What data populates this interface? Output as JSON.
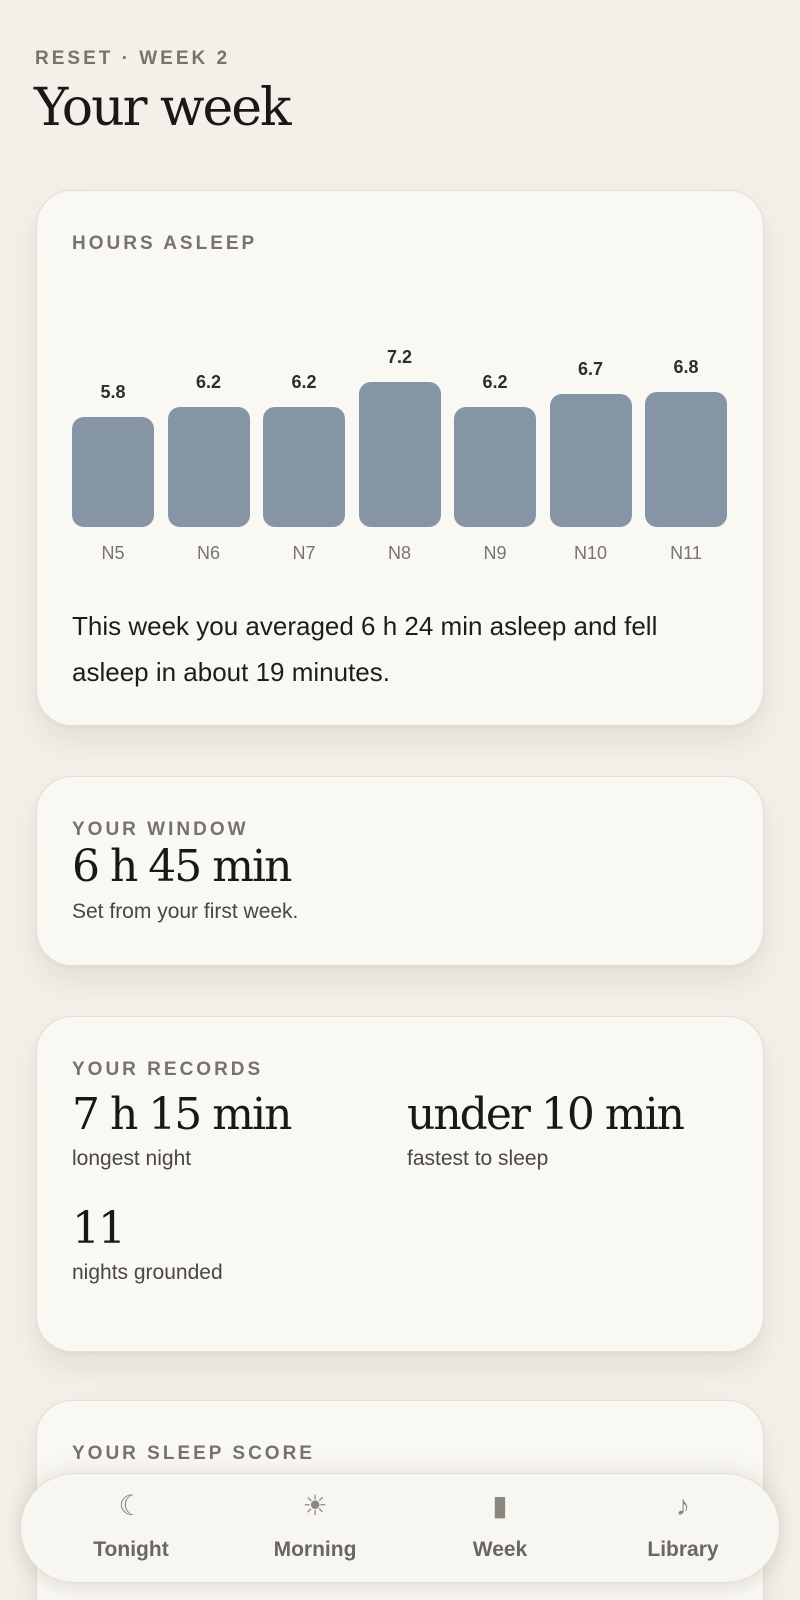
{
  "header": {
    "eyebrow": "RESET · WEEK 2",
    "title": "Your week"
  },
  "hours_card": {
    "label": "HOURS ASLEEP",
    "summary": "This week you averaged 6 h 24 min asleep and fell asleep in about 19 minutes."
  },
  "chart_data": {
    "type": "bar",
    "title": "HOURS ASLEEP",
    "categories": [
      "N5",
      "N6",
      "N7",
      "N8",
      "N9",
      "N10",
      "N11"
    ],
    "values": [
      5.8,
      6.2,
      6.2,
      7.2,
      6.2,
      6.7,
      6.8
    ],
    "value_labels": [
      "5.8",
      "6.2",
      "6.2",
      "7.2",
      "6.2",
      "6.7",
      "6.8"
    ],
    "bar_color": "#8595a6",
    "grid": false
  },
  "window_card": {
    "label": "YOUR WINDOW",
    "value": "6 h 45 min",
    "note": "Set from your first week."
  },
  "records_card": {
    "label": "YOUR RECORDS",
    "records": [
      {
        "value": "7 h 15 min",
        "caption": "longest night"
      },
      {
        "value": "under 10 min",
        "caption": "fastest to sleep"
      },
      {
        "value": "11",
        "caption": "nights grounded"
      }
    ]
  },
  "score_card": {
    "label": "YOUR SLEEP SCORE"
  },
  "nav": {
    "items": [
      {
        "label": "Tonight",
        "icon": "moon-icon",
        "glyph": "☾"
      },
      {
        "label": "Morning",
        "icon": "sun-icon",
        "glyph": "☀"
      },
      {
        "label": "Week",
        "icon": "bar-icon",
        "glyph": "▮"
      },
      {
        "label": "Library",
        "icon": "music-note-icon",
        "glyph": "♪"
      }
    ]
  },
  "colors": {
    "background": "#f3f0e9",
    "card": "#faf8f3",
    "bar": "#8595a6",
    "muted_label": "#76736a"
  }
}
